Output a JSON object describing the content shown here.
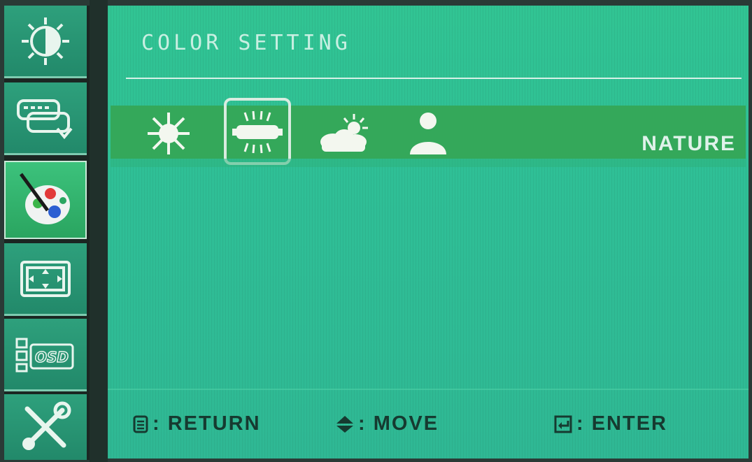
{
  "sidebar": {
    "items": [
      {
        "icon": "brightness-contrast-icon",
        "selected": false
      },
      {
        "icon": "input-source-icon",
        "selected": false
      },
      {
        "icon": "color-palette-icon",
        "selected": true
      },
      {
        "icon": "image-position-icon",
        "selected": false
      },
      {
        "icon": "osd-setup-icon",
        "selected": false,
        "label": "OSD"
      },
      {
        "icon": "tools-icon",
        "selected": false
      }
    ]
  },
  "panel": {
    "title": "COLOR SETTING",
    "modes": [
      {
        "icon": "sun-icon",
        "selected": false
      },
      {
        "icon": "fluorescent-lamp-icon",
        "selected": true
      },
      {
        "icon": "cloudy-sun-icon",
        "selected": false
      },
      {
        "icon": "user-icon",
        "selected": false
      }
    ],
    "current_mode": "NATURE"
  },
  "footer": {
    "return_label": ": RETURN",
    "move_label": ": MOVE",
    "enter_label": ": ENTER"
  },
  "colors": {
    "panel_bg": "#2fbf96",
    "band": "#34a85a",
    "sidebar_item": "#2a977a",
    "sidebar_selected": "#3cc27c"
  }
}
